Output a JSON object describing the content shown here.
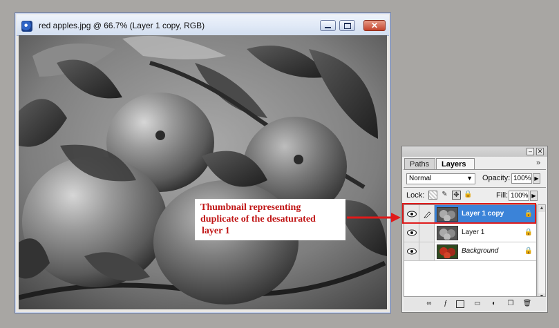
{
  "document_window": {
    "title": "red apples.jpg @ 66.7% (Layer 1 copy, RGB)",
    "controls": {
      "minimize_icon": "minimize-icon",
      "maximize_icon": "maximize-icon",
      "close_icon": "close-icon"
    }
  },
  "annotation": {
    "lines": [
      "Thumbnail representing",
      "duplicate of the desaturated",
      "layer 1"
    ],
    "color": "#c01414"
  },
  "layers_panel": {
    "tabs": [
      {
        "label": "Paths"
      },
      {
        "label": "Layers",
        "active": true
      }
    ],
    "menu_glyph": "»",
    "blend_mode": "Normal",
    "opacity_label": "Opacity:",
    "opacity_value": "100%",
    "lock_label": "Lock:",
    "fill_label": "Fill:",
    "fill_value": "100%",
    "layers": [
      {
        "name": "Layer 1 copy",
        "selected": true,
        "visible": true,
        "thumbnail": "grayscale-apples"
      },
      {
        "name": "Layer 1",
        "selected": false,
        "visible": true,
        "thumbnail": "grayscale-apples"
      },
      {
        "name": "Background",
        "selected": false,
        "visible": true,
        "thumbnail": "color-apples",
        "italic": true
      }
    ],
    "footer_icons": [
      "link-layers-icon",
      "add-style-icon",
      "add-mask-icon",
      "new-group-icon",
      "adjustment-layer-icon",
      "new-layer-icon",
      "delete-layer-icon"
    ]
  },
  "colors": {
    "selected_layer": "#3b83d8",
    "highlight": "#e01a1a"
  }
}
